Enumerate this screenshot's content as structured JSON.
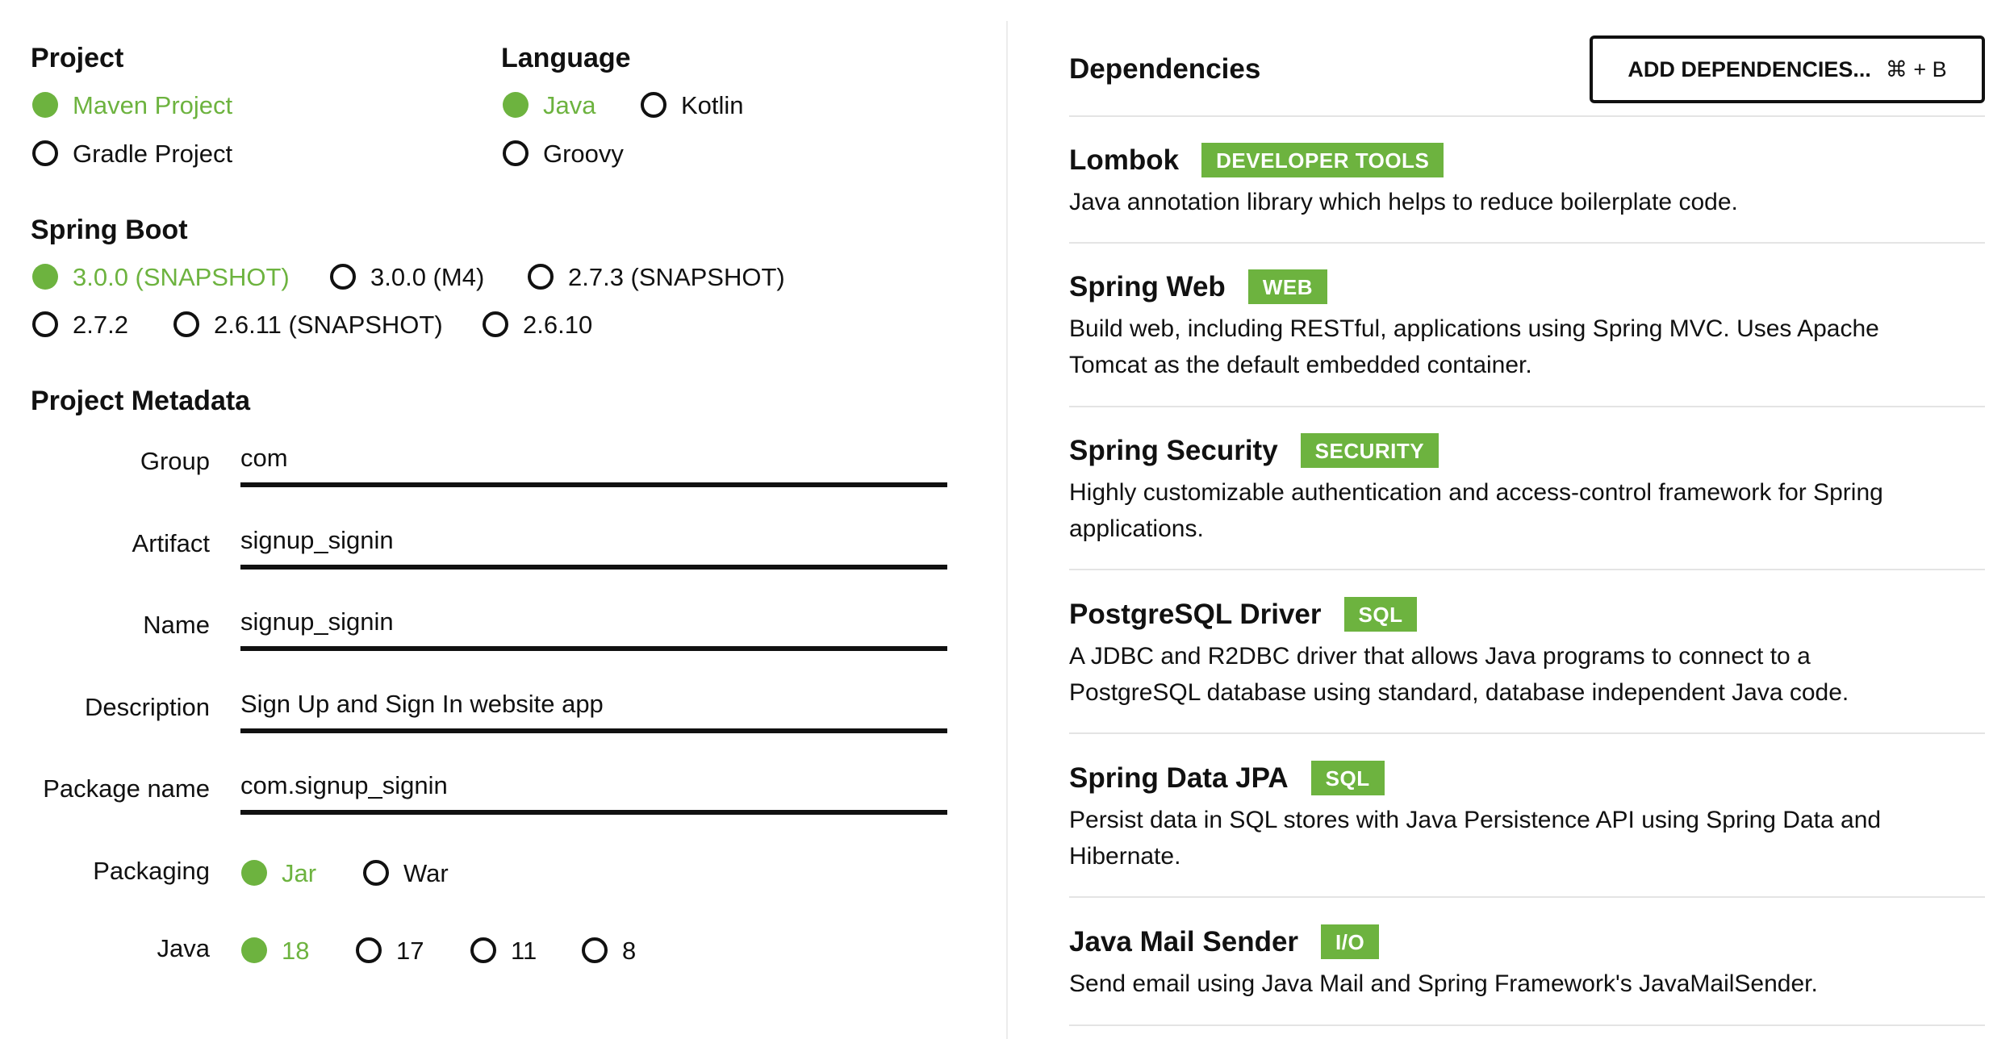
{
  "project": {
    "heading": "Project",
    "options": [
      {
        "label": "Maven Project",
        "checked": true
      },
      {
        "label": "Gradle Project",
        "checked": false
      }
    ]
  },
  "language": {
    "heading": "Language",
    "options": [
      {
        "label": "Java",
        "checked": true
      },
      {
        "label": "Kotlin",
        "checked": false
      },
      {
        "label": "Groovy",
        "checked": false
      }
    ]
  },
  "spring_boot": {
    "heading": "Spring Boot",
    "options": [
      {
        "label": "3.0.0 (SNAPSHOT)",
        "checked": true
      },
      {
        "label": "3.0.0 (M4)",
        "checked": false
      },
      {
        "label": "2.7.3 (SNAPSHOT)",
        "checked": false
      },
      {
        "label": "2.7.2",
        "checked": false
      },
      {
        "label": "2.6.11 (SNAPSHOT)",
        "checked": false
      },
      {
        "label": "2.6.10",
        "checked": false
      }
    ]
  },
  "metadata": {
    "heading": "Project Metadata",
    "group": {
      "label": "Group",
      "value": "com"
    },
    "artifact": {
      "label": "Artifact",
      "value": "signup_signin"
    },
    "name": {
      "label": "Name",
      "value": "signup_signin"
    },
    "description": {
      "label": "Description",
      "value": "Sign Up and Sign In website app"
    },
    "package_name": {
      "label": "Package name",
      "value": "com.signup_signin"
    },
    "packaging": {
      "label": "Packaging",
      "options": [
        {
          "label": "Jar",
          "checked": true
        },
        {
          "label": "War",
          "checked": false
        }
      ]
    },
    "java": {
      "label": "Java",
      "options": [
        {
          "label": "18",
          "checked": true
        },
        {
          "label": "17",
          "checked": false
        },
        {
          "label": "11",
          "checked": false
        },
        {
          "label": "8",
          "checked": false
        }
      ]
    }
  },
  "dependencies": {
    "heading": "Dependencies",
    "add_button": {
      "label": "ADD DEPENDENCIES...",
      "shortcut": "⌘ + B"
    },
    "items": [
      {
        "name": "Lombok",
        "tag": "DEVELOPER TOOLS",
        "description": "Java annotation library which helps to reduce boilerplate code."
      },
      {
        "name": "Spring Web",
        "tag": "WEB",
        "description": "Build web, including RESTful, applications using Spring MVC. Uses Apache Tomcat as the default embedded container."
      },
      {
        "name": "Spring Security",
        "tag": "SECURITY",
        "description": "Highly customizable authentication and access-control framework for Spring applications."
      },
      {
        "name": "PostgreSQL Driver",
        "tag": "SQL",
        "description": "A JDBC and R2DBC driver that allows Java programs to connect to a PostgreSQL database using standard, database independent Java code."
      },
      {
        "name": "Spring Data JPA",
        "tag": "SQL",
        "description": "Persist data in SQL stores with Java Persistence API using Spring Data and Hibernate."
      },
      {
        "name": "Java Mail Sender",
        "tag": "I/O",
        "description": "Send email using Java Mail and Spring Framework's JavaMailSender."
      }
    ]
  },
  "colors": {
    "accent": "#6db33f",
    "text": "#111111",
    "divider": "#e4e4e4"
  }
}
